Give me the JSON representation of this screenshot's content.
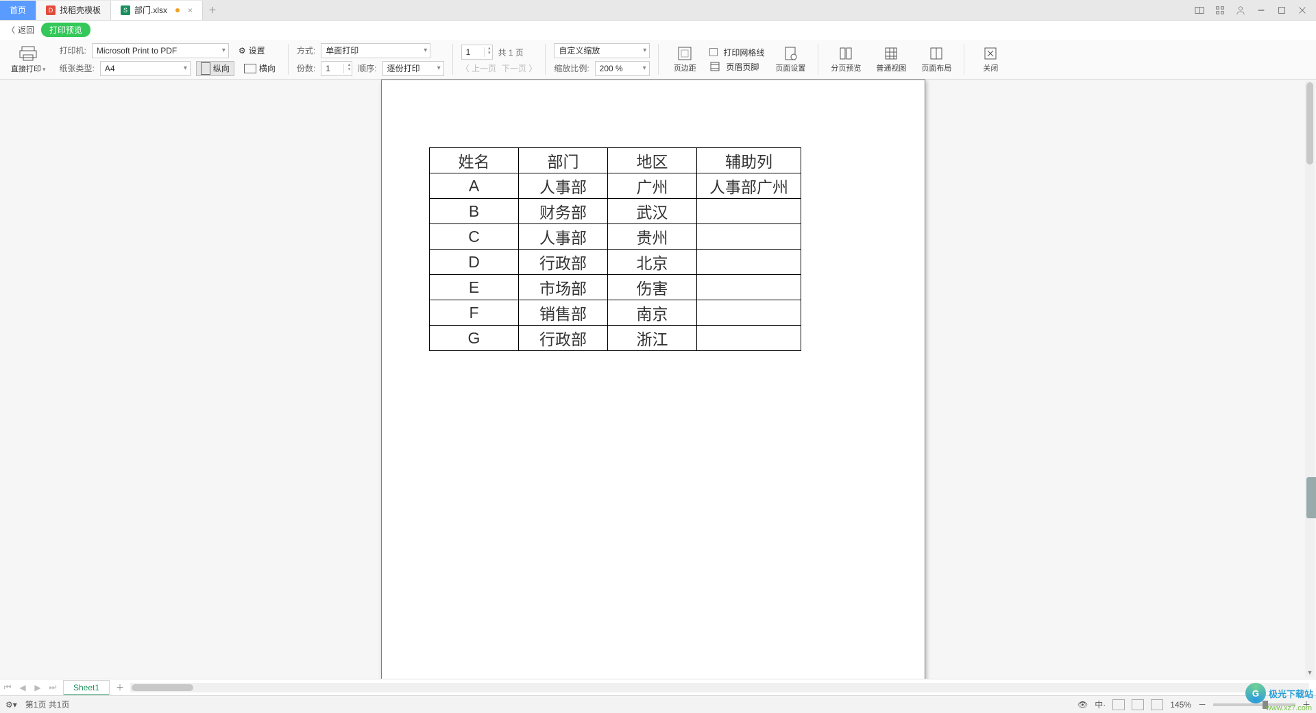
{
  "tabs": {
    "home": "首页",
    "template": "找稻壳模板",
    "file": "部门.xlsx"
  },
  "header": {
    "back": "返回",
    "pill": "打印预览"
  },
  "ribbon": {
    "direct_print": "直接打印",
    "printer_label": "打印机:",
    "printer_value": "Microsoft Print to PDF",
    "settings": "设置",
    "paper_type_label": "纸张类型:",
    "paper_type_value": "A4",
    "portrait": "纵向",
    "landscape": "横向",
    "mode_label": "方式:",
    "mode_value": "单面打印",
    "copies_label": "份数:",
    "copies_value": "1",
    "order_label": "顺序:",
    "order_value": "逐份打印",
    "page_input": "1",
    "page_total_label": "共 1 页",
    "prev_page": "上一页",
    "next_page": "下一页",
    "zoom_mode_value": "自定义缩放",
    "zoom_ratio_label": "缩放比例:",
    "zoom_ratio_value": "200 %",
    "margins": "页边距",
    "gridlines": "打印网格线",
    "header_footer": "页眉页脚",
    "page_setup": "页面设置",
    "page_break_preview": "分页预览",
    "normal_view": "普通视图",
    "page_layout": "页面布局",
    "close": "关闭"
  },
  "table": {
    "headers": [
      "姓名",
      "部门",
      "地区",
      "辅助列"
    ],
    "rows": [
      [
        "A",
        "人事部",
        "广州",
        "人事部广州"
      ],
      [
        "B",
        "财务部",
        "武汉",
        ""
      ],
      [
        "C",
        "人事部",
        "贵州",
        ""
      ],
      [
        "D",
        "行政部",
        "北京",
        ""
      ],
      [
        "E",
        "市场部",
        "伤害",
        ""
      ],
      [
        "F",
        "销售部",
        "南京",
        ""
      ],
      [
        "G",
        "行政部",
        "浙江",
        ""
      ]
    ]
  },
  "sheets": {
    "active": "Sheet1"
  },
  "status": {
    "page_info": "第1页 共1页",
    "zoom": "145%",
    "lang": "中·"
  },
  "watermark": {
    "title": "极光下载站",
    "url": "www.xz7.com"
  }
}
